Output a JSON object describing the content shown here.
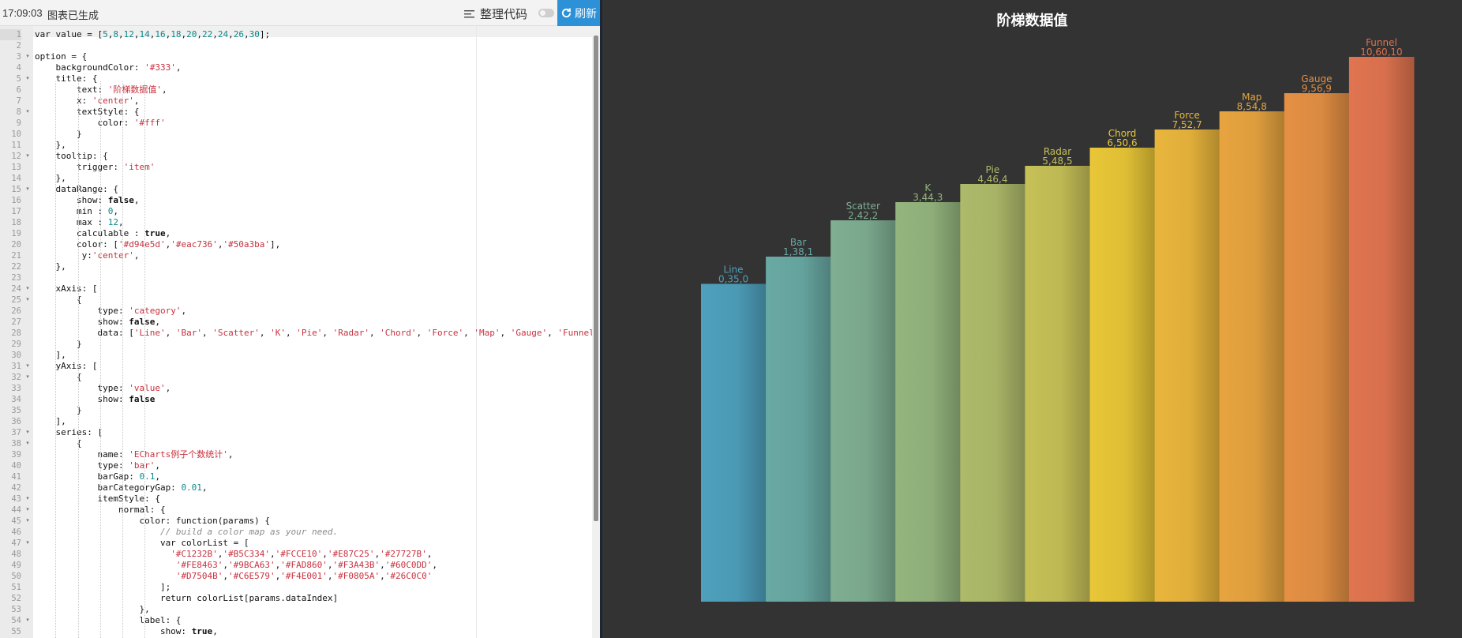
{
  "status": {
    "time": "17:09:03",
    "message": "图表已生成"
  },
  "toolbar": {
    "format_label": "整理代码",
    "refresh_label": "刷新"
  },
  "code": {
    "lines": [
      [
        [
          "var value = [",
          ""
        ],
        [
          "5",
          "teal"
        ],
        [
          ",",
          ""
        ],
        [
          "8",
          "teal"
        ],
        [
          ",",
          ""
        ],
        [
          "12",
          "teal"
        ],
        [
          ",",
          ""
        ],
        [
          "14",
          "teal"
        ],
        [
          ",",
          ""
        ],
        [
          "16",
          "teal"
        ],
        [
          ",",
          ""
        ],
        [
          "18",
          "teal"
        ],
        [
          ",",
          ""
        ],
        [
          "20",
          "teal"
        ],
        [
          ",",
          ""
        ],
        [
          "22",
          "teal"
        ],
        [
          ",",
          ""
        ],
        [
          "24",
          "teal"
        ],
        [
          ",",
          ""
        ],
        [
          "26",
          "teal"
        ],
        [
          ",",
          ""
        ],
        [
          "30",
          "teal"
        ],
        [
          "];",
          ""
        ]
      ],
      [],
      [
        [
          "option = {",
          ""
        ]
      ],
      [
        [
          "    backgroundColor: ",
          ""
        ],
        [
          "'#333'",
          "red"
        ],
        [
          ",",
          ""
        ]
      ],
      [
        [
          "    title: {",
          ""
        ]
      ],
      [
        [
          "        text: ",
          ""
        ],
        [
          "'阶梯数据值'",
          "red"
        ],
        [
          ",",
          ""
        ]
      ],
      [
        [
          "        x: ",
          ""
        ],
        [
          "'center'",
          "red"
        ],
        [
          ",",
          ""
        ]
      ],
      [
        [
          "        textStyle: {",
          ""
        ]
      ],
      [
        [
          "            color: ",
          ""
        ],
        [
          "'#fff'",
          "red"
        ]
      ],
      [
        [
          "        }",
          ""
        ]
      ],
      [
        [
          "    },",
          ""
        ]
      ],
      [
        [
          "    tooltip: {",
          ""
        ]
      ],
      [
        [
          "        trigger: ",
          ""
        ],
        [
          "'item'",
          "red"
        ]
      ],
      [
        [
          "    },",
          ""
        ]
      ],
      [
        [
          "    dataRange: {",
          ""
        ]
      ],
      [
        [
          "        show: ",
          ""
        ],
        [
          "false",
          "b"
        ],
        [
          ",",
          ""
        ]
      ],
      [
        [
          "        min : ",
          ""
        ],
        [
          "0",
          "teal"
        ],
        [
          ",",
          ""
        ]
      ],
      [
        [
          "        max : ",
          ""
        ],
        [
          "12",
          "teal"
        ],
        [
          ",",
          ""
        ]
      ],
      [
        [
          "        calculable : ",
          ""
        ],
        [
          "true",
          "b"
        ],
        [
          ",",
          ""
        ]
      ],
      [
        [
          "        color: [",
          ""
        ],
        [
          "'#d94e5d'",
          "red"
        ],
        [
          ",",
          ""
        ],
        [
          "'#eac736'",
          "red"
        ],
        [
          ",",
          ""
        ],
        [
          "'#50a3ba'",
          "red"
        ],
        [
          "],",
          ""
        ]
      ],
      [
        [
          "         y:",
          ""
        ],
        [
          "'center'",
          "red"
        ],
        [
          ",",
          ""
        ]
      ],
      [
        [
          "    },",
          ""
        ]
      ],
      [],
      [
        [
          "    xAxis: [",
          ""
        ]
      ],
      [
        [
          "        {",
          ""
        ]
      ],
      [
        [
          "            type: ",
          ""
        ],
        [
          "'category'",
          "red"
        ],
        [
          ",",
          ""
        ]
      ],
      [
        [
          "            show: ",
          ""
        ],
        [
          "false",
          "b"
        ],
        [
          ",",
          ""
        ]
      ],
      [
        [
          "            data: [",
          ""
        ],
        [
          "'Line'",
          "red"
        ],
        [
          ", ",
          ""
        ],
        [
          "'Bar'",
          "red"
        ],
        [
          ", ",
          ""
        ],
        [
          "'Scatter'",
          "red"
        ],
        [
          ", ",
          ""
        ],
        [
          "'K'",
          "red"
        ],
        [
          ", ",
          ""
        ],
        [
          "'Pie'",
          "red"
        ],
        [
          ", ",
          ""
        ],
        [
          "'Radar'",
          "red"
        ],
        [
          ", ",
          ""
        ],
        [
          "'Chord'",
          "red"
        ],
        [
          ", ",
          ""
        ],
        [
          "'Force'",
          "red"
        ],
        [
          ", ",
          ""
        ],
        [
          "'Map'",
          "red"
        ],
        [
          ", ",
          ""
        ],
        [
          "'Gauge'",
          "red"
        ],
        [
          ", ",
          ""
        ],
        [
          "'Funnel'",
          "red"
        ],
        [
          "]",
          ""
        ]
      ],
      [
        [
          "        }",
          ""
        ]
      ],
      [
        [
          "    ],",
          ""
        ]
      ],
      [
        [
          "    yAxis: [",
          ""
        ]
      ],
      [
        [
          "        {",
          ""
        ]
      ],
      [
        [
          "            type: ",
          ""
        ],
        [
          "'value'",
          "red"
        ],
        [
          ",",
          ""
        ]
      ],
      [
        [
          "            show: ",
          ""
        ],
        [
          "false",
          "b"
        ]
      ],
      [
        [
          "        }",
          ""
        ]
      ],
      [
        [
          "    ],",
          ""
        ]
      ],
      [
        [
          "    series: [",
          ""
        ]
      ],
      [
        [
          "        {",
          ""
        ]
      ],
      [
        [
          "            name: ",
          ""
        ],
        [
          "'ECharts例子个数统计'",
          "red"
        ],
        [
          ",",
          ""
        ]
      ],
      [
        [
          "            type: ",
          ""
        ],
        [
          "'bar'",
          "red"
        ],
        [
          ",",
          ""
        ]
      ],
      [
        [
          "            barGap: ",
          ""
        ],
        [
          "0.1",
          "teal"
        ],
        [
          ",",
          ""
        ]
      ],
      [
        [
          "            barCategoryGap: ",
          ""
        ],
        [
          "0.01",
          "teal"
        ],
        [
          ",",
          ""
        ]
      ],
      [
        [
          "            itemStyle: {",
          ""
        ]
      ],
      [
        [
          "                normal: {",
          ""
        ]
      ],
      [
        [
          "                    color: function(params) {",
          ""
        ]
      ],
      [
        [
          "                        ",
          ""
        ],
        [
          "// build a color map as your need.",
          "cm"
        ]
      ],
      [
        [
          "                        var colorList = [",
          ""
        ]
      ],
      [
        [
          "                          ",
          ""
        ],
        [
          "'#C1232B'",
          "red"
        ],
        [
          ",",
          ""
        ],
        [
          "'#B5C334'",
          "red"
        ],
        [
          ",",
          ""
        ],
        [
          "'#FCCE10'",
          "red"
        ],
        [
          ",",
          ""
        ],
        [
          "'#E87C25'",
          "red"
        ],
        [
          ",",
          ""
        ],
        [
          "'#27727B'",
          "red"
        ],
        [
          ",",
          ""
        ]
      ],
      [
        [
          "                           ",
          ""
        ],
        [
          "'#FE8463'",
          "red"
        ],
        [
          ",",
          ""
        ],
        [
          "'#9BCA63'",
          "red"
        ],
        [
          ",",
          ""
        ],
        [
          "'#FAD860'",
          "red"
        ],
        [
          ",",
          ""
        ],
        [
          "'#F3A43B'",
          "red"
        ],
        [
          ",",
          ""
        ],
        [
          "'#60C0DD'",
          "red"
        ],
        [
          ",",
          ""
        ]
      ],
      [
        [
          "                           ",
          ""
        ],
        [
          "'#D7504B'",
          "red"
        ],
        [
          ",",
          ""
        ],
        [
          "'#C6E579'",
          "red"
        ],
        [
          ",",
          ""
        ],
        [
          "'#F4E001'",
          "red"
        ],
        [
          ",",
          ""
        ],
        [
          "'#F0805A'",
          "red"
        ],
        [
          ",",
          ""
        ],
        [
          "'#26C0C0'",
          "red"
        ]
      ],
      [
        [
          "                        ];",
          ""
        ]
      ],
      [
        [
          "                        return colorList[params.dataIndex]",
          ""
        ]
      ],
      [
        [
          "                    },",
          ""
        ]
      ],
      [
        [
          "                    label: {",
          ""
        ]
      ],
      [
        [
          "                        show: ",
          ""
        ],
        [
          "true",
          "b"
        ],
        [
          ",",
          ""
        ]
      ],
      [
        [
          "                        position: ",
          ""
        ],
        [
          "'top'",
          "red"
        ],
        [
          ",",
          ""
        ]
      ]
    ]
  },
  "chart_data": {
    "type": "bar",
    "title": "阶梯数据值",
    "categories": [
      "Line",
      "Bar",
      "Scatter",
      "K",
      "Pie",
      "Radar",
      "Chord",
      "Force",
      "Map",
      "Gauge",
      "Funnel"
    ],
    "values": [
      35,
      38,
      42,
      44,
      46,
      48,
      50,
      52,
      54,
      56,
      60
    ],
    "labels": [
      "0,35,0",
      "1,38,1",
      "2,42,2",
      "3,44,3",
      "4,46,4",
      "5,48,5",
      "6,50,6",
      "7,52,7",
      "8,54,8",
      "9,56,9",
      "10,60,10"
    ],
    "colors": [
      "#4ea0bc",
      "#69a9a4",
      "#7fae92",
      "#94b57e",
      "#aeba6a",
      "#c6c057",
      "#e8c637",
      "#e9b53c",
      "#e7a43f",
      "#e49044",
      "#e07450"
    ],
    "ylim": [
      0,
      60
    ],
    "background": "#333333",
    "grid": false,
    "legend": "none"
  }
}
